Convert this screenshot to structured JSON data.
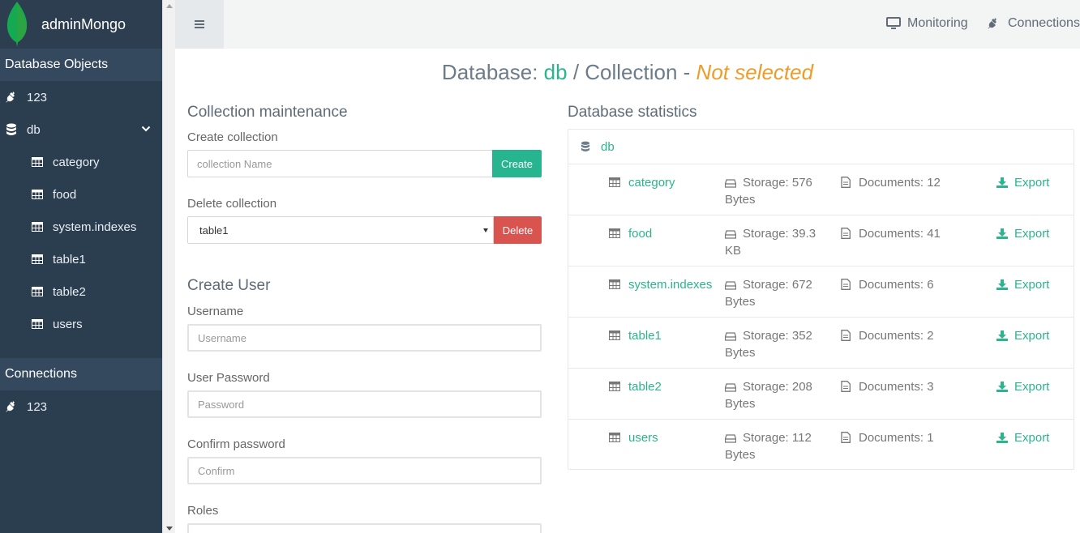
{
  "brand": {
    "title": "adminMongo"
  },
  "sidebar": {
    "database_objects_title": "Database Objects",
    "items": [
      {
        "label": "123",
        "icon": "plug-icon"
      },
      {
        "label": "db",
        "icon": "database-icon",
        "expanded": true,
        "children": [
          "category",
          "food",
          "system.indexes",
          "table1",
          "table2",
          "users"
        ]
      }
    ],
    "connections_title": "Connections",
    "connections": [
      {
        "label": "123",
        "icon": "plug-icon"
      }
    ]
  },
  "topbar": {
    "menu_icon": "hamburger-icon",
    "monitoring_label": "Monitoring",
    "connections_label": "Connections"
  },
  "heading": {
    "prefix": "Database: ",
    "db": "db",
    "middle": " / Collection - ",
    "collection": "Not selected"
  },
  "collection_maintenance": {
    "title": "Collection maintenance",
    "create_label": "Create collection",
    "create_placeholder": "collection Name",
    "create_button": "Create",
    "delete_label": "Delete collection",
    "delete_selected": "table1",
    "delete_button": "Delete"
  },
  "create_user": {
    "title": "Create User",
    "username_label": "Username",
    "username_placeholder": "Username",
    "password_label": "User Password",
    "password_placeholder": "Password",
    "confirm_label": "Confirm password",
    "confirm_placeholder": "Confirm",
    "roles_label": "Roles"
  },
  "stats": {
    "title": "Database statistics",
    "db_name": "db",
    "rows": [
      {
        "name": "category",
        "storage": "Storage: 576 Bytes",
        "documents": "Documents: 12",
        "export": "Export"
      },
      {
        "name": "food",
        "storage": "Storage: 39.3 KB",
        "documents": "Documents: 41",
        "export": "Export"
      },
      {
        "name": "system.indexes",
        "storage": "Storage: 672 Bytes",
        "documents": "Documents: 6",
        "export": "Export"
      },
      {
        "name": "table1",
        "storage": "Storage: 352 Bytes",
        "documents": "Documents: 2",
        "export": "Export"
      },
      {
        "name": "table2",
        "storage": "Storage: 208 Bytes",
        "documents": "Documents: 3",
        "export": "Export"
      },
      {
        "name": "users",
        "storage": "Storage: 112 Bytes",
        "documents": "Documents: 1",
        "export": "Export"
      }
    ]
  },
  "colors": {
    "accent": "#2bb48d",
    "warning": "#ed9c28",
    "danger": "#d9534f",
    "sidebar": "#2b3e50"
  }
}
